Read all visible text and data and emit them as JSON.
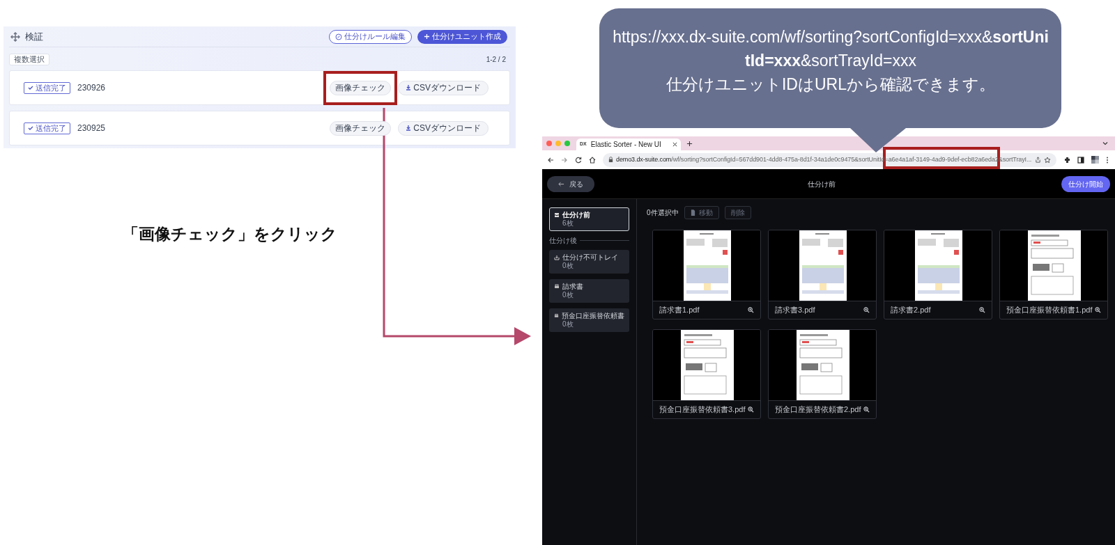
{
  "left_screen": {
    "title": "検証",
    "header_buttons": [
      {
        "label": "仕分けルール編集",
        "kind": "outline"
      },
      {
        "label": "仕分けユニット作成",
        "kind": "primary"
      }
    ],
    "multi_select": "複数選択",
    "count": "1-2 / 2",
    "rows": [
      {
        "status": "送信完了",
        "id": "230926",
        "buttons": [
          "画像チェック",
          "CSVダウンロード"
        ],
        "highlighted": true
      },
      {
        "status": "送信完了",
        "id": "230925",
        "buttons": [
          "画像チェック",
          "CSVダウンロード"
        ],
        "highlighted": false
      }
    ]
  },
  "caption": "「画像チェック」をクリック",
  "callout": {
    "url": "https://xxx.dx-suite.com/wf/sorting?sortConfigId=xxx&**sortUnitId=xxx**&sortTrayId=xxx",
    "note": "仕分けユニットIDはURLから確認できます。"
  },
  "browser": {
    "tab_icon": "DX",
    "tab_title": "Elastic Sorter - New UI",
    "url_host": "demo3.dx-suite.com",
    "url_path": "/wf/sorting?sortConfigId=567dd901-4dd8-475a-8d1f-34a1de0c9475&sortUnitId=a6e4a1af-3149-4ad9-9def-ecb82a6eda2&sortTrayI...",
    "app": {
      "back": "戻る",
      "title": "仕分け前",
      "start": "仕分け開始",
      "trays": [
        {
          "name": "仕分け前",
          "count": "6枚",
          "selected": true,
          "kind": "inbox"
        }
      ],
      "section": "仕分け後",
      "sorted_trays": [
        {
          "name": "仕分け不可トレイ",
          "count": "0枚",
          "selected": false,
          "kind": "tray"
        },
        {
          "name": "請求書",
          "count": "0枚",
          "selected": false,
          "kind": "printer"
        },
        {
          "name": "預金口座振替依頼書",
          "count": "0枚",
          "selected": false,
          "kind": "printer"
        }
      ],
      "selection": "0件選択中",
      "actions": [
        {
          "label": "移動",
          "disabled": true,
          "kind": "file"
        },
        {
          "label": "削除",
          "disabled": true,
          "kind": "plain"
        }
      ],
      "files": [
        {
          "name": "請求書1.pdf",
          "kind": "invoice"
        },
        {
          "name": "請求書3.pdf",
          "kind": "invoice"
        },
        {
          "name": "請求書2.pdf",
          "kind": "invoice"
        },
        {
          "name": "預金口座振替依頼書1.pdf",
          "kind": "form"
        },
        {
          "name": "預金口座振替依頼書3.pdf",
          "kind": "form"
        },
        {
          "name": "預金口座振替依頼書2.pdf",
          "kind": "form"
        }
      ]
    }
  }
}
